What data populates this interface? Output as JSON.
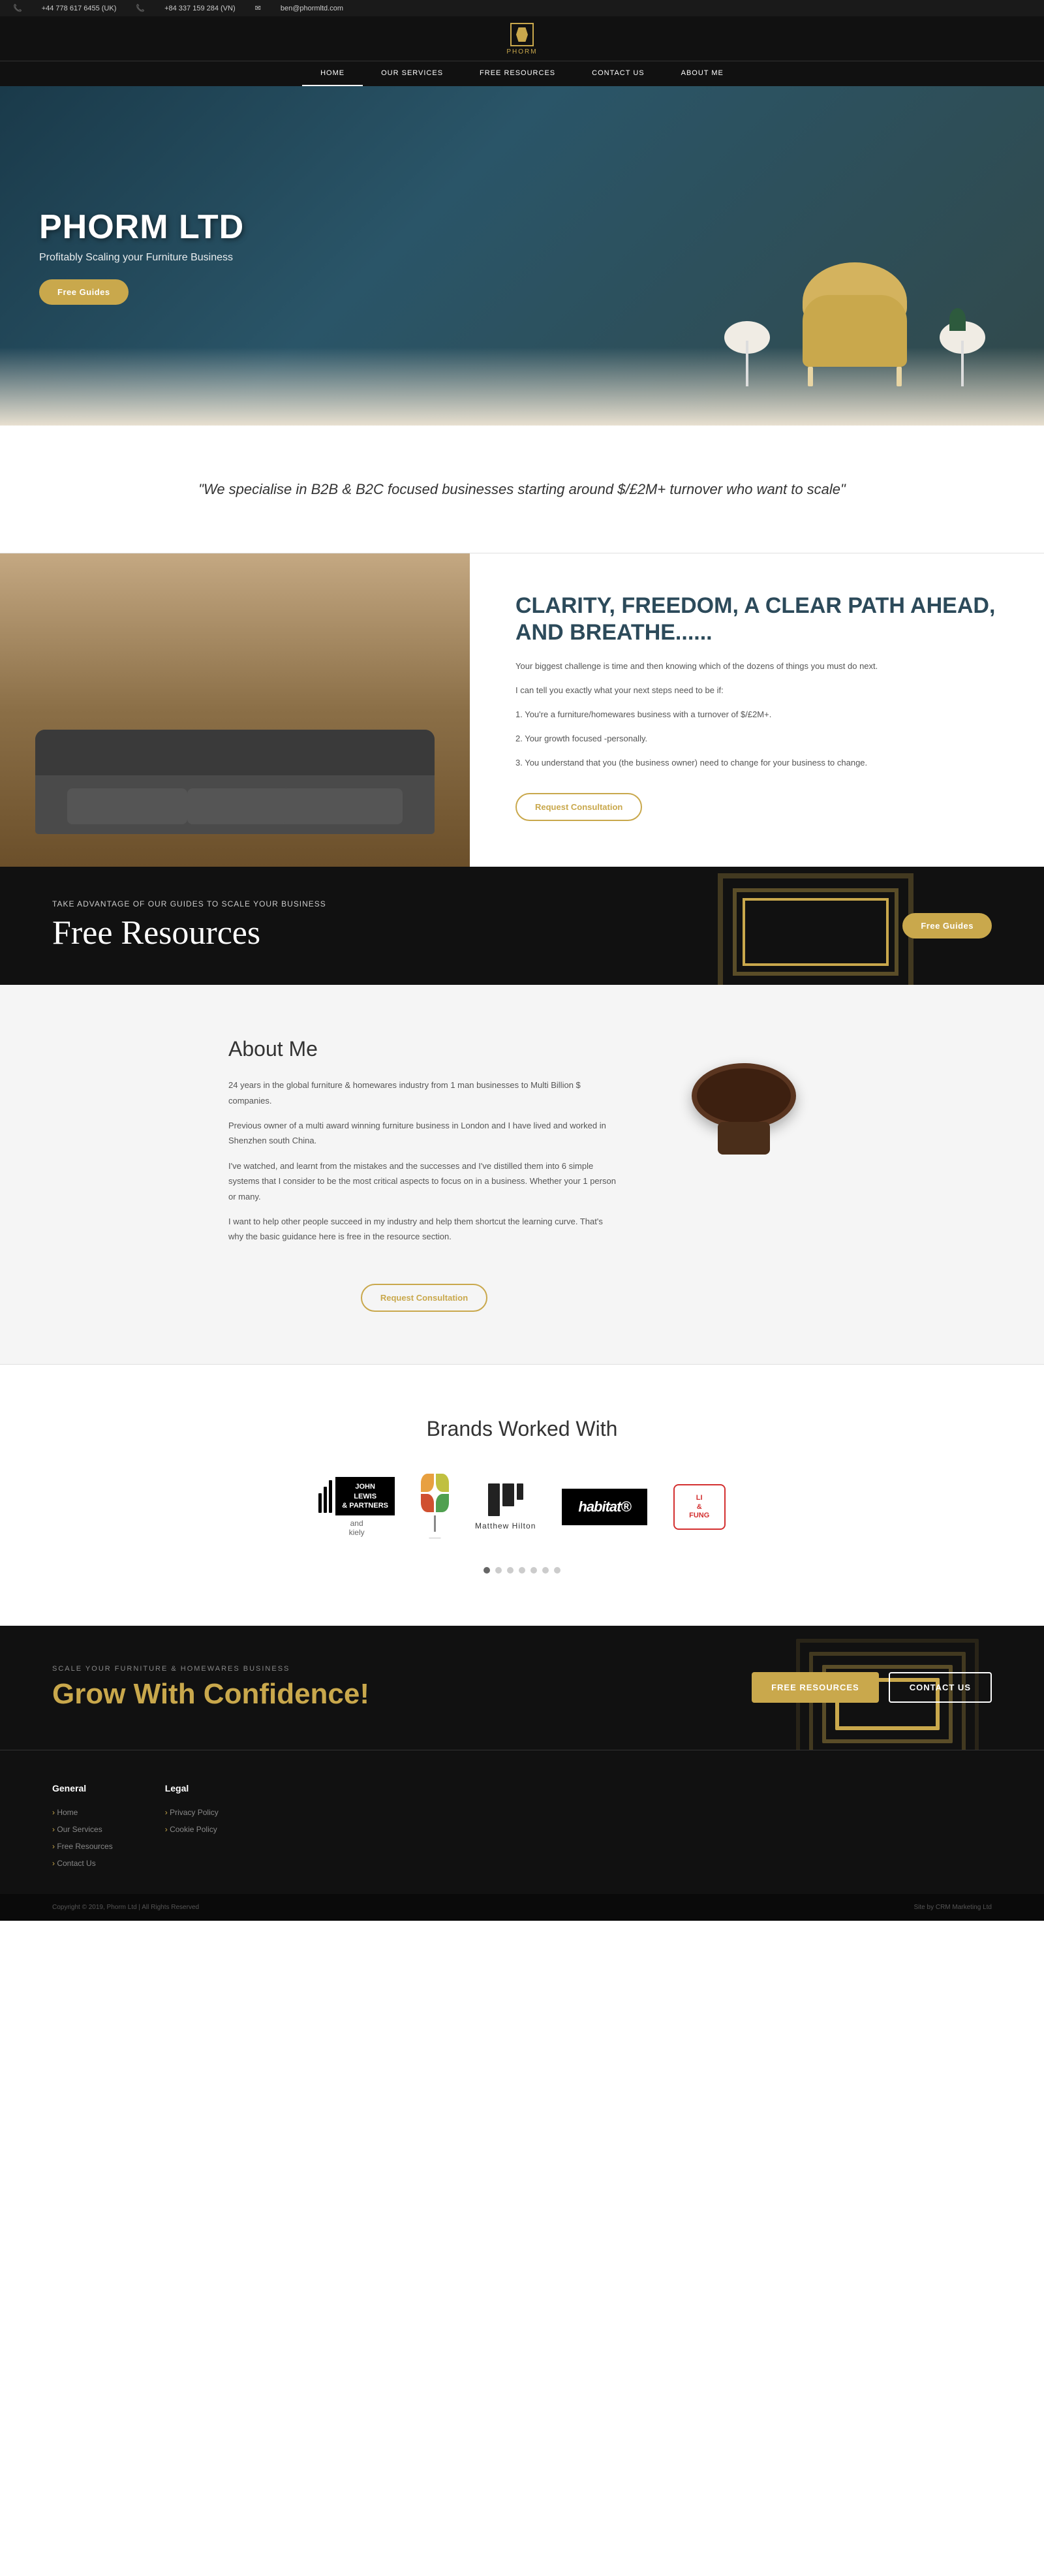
{
  "topbar": {
    "phone1": "+44 778 617 6455 (UK)",
    "phone2": "+84 337 159 284 (VN)",
    "email": "ben@phormltd.com"
  },
  "nav": {
    "logo_name": "PHORM",
    "links": [
      {
        "label": "HOME",
        "active": true
      },
      {
        "label": "OUR SERVICES",
        "active": false
      },
      {
        "label": "FREE RESOURCES",
        "active": false
      },
      {
        "label": "CONTACT US",
        "active": false
      },
      {
        "label": "ABOUT ME",
        "active": false
      }
    ]
  },
  "hero": {
    "title": "PHORM LTD",
    "subtitle": "Profitably Scaling your Furniture Business",
    "cta_label": "Free Guides"
  },
  "quote": {
    "text": "\"We specialise in B2B & B2C focused businesses starting around $/£2M+ turnover who want to scale\""
  },
  "clarity": {
    "title": "CLARITY, FREEDOM, A CLEAR PATH AHEAD, AND BREATHE......",
    "para1": "Your biggest challenge is time and then knowing which of the dozens of things you must do next.",
    "para2": "I can tell you exactly what your next steps need to be if:",
    "points": [
      "1. You're a furniture/homewares business with a turnover of $/£2M+.",
      "2. Your growth focused -personally.",
      "3. You understand that you (the business owner) need to change for your business to change."
    ],
    "cta_label": "Request Consultation"
  },
  "resources": {
    "tag": "Take Advantage Of Our Guides to Scale Your Business",
    "title": "Free Resources",
    "cta_label": "Free Guides"
  },
  "about": {
    "title": "About Me",
    "para1": "24 years in the global furniture & homewares industry from 1 man businesses to Multi Billion $ companies.",
    "para2": "Previous owner of a multi award winning furniture business in London and I have lived and worked in Shenzhen south China.",
    "para3": "I've watched, and learnt from the mistakes and the successes and I've distilled them into 6 simple systems that I consider to be the most critical aspects to focus on in a business. Whether your 1 person or many.",
    "para4": "I want to help other people succeed in my industry and help them shortcut the learning curve. That's why the basic guidance here is free in the resource section.",
    "cta_label": "Request Consultation"
  },
  "brands": {
    "title": "Brands Worked With",
    "items": [
      {
        "name": "John Lewis & Partners and kiely",
        "type": "jl"
      },
      {
        "name": "Leaf Plant Brand",
        "type": "plant"
      },
      {
        "name": "Matthew Hilton",
        "type": "matthew"
      },
      {
        "name": "Habitat",
        "type": "habitat"
      },
      {
        "name": "Li & Fung",
        "type": "lf"
      }
    ],
    "dots": [
      true,
      false,
      false,
      false,
      false,
      false,
      false
    ]
  },
  "footer_cta": {
    "tag": "SCALE YOUR FURNITURE & HOMEWARES BUSINESS",
    "title_part1": "Grow With Confidence!",
    "btn1_label": "FREE RESOURCES",
    "btn2_label": "CONTACT US"
  },
  "footer_links": {
    "col1_title": "General",
    "col1_links": [
      "Home",
      "Our Services",
      "Free Resources",
      "Contact Us"
    ],
    "col2_title": "Legal",
    "col2_links": [
      "Privacy Policy",
      "Cookie Policy"
    ]
  },
  "footer_bottom": {
    "copyright": "Copyright © 2019, Phorm Ltd | All Rights Reserved",
    "credit": "Site by CRM Marketing Ltd"
  }
}
